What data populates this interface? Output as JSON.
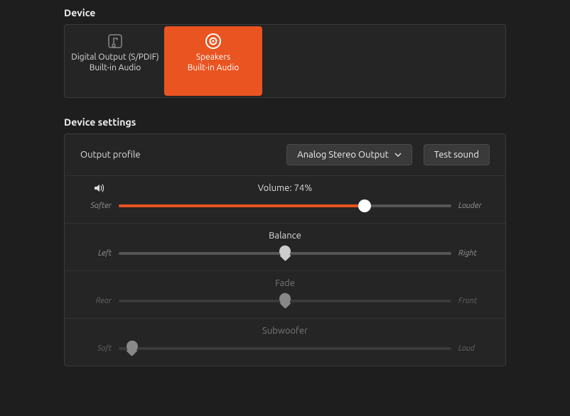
{
  "sections": {
    "device": "Device",
    "settings": "Device settings"
  },
  "devices": [
    {
      "title": "Digital Output (S/PDIF)",
      "subtitle": "Built-in Audio",
      "icon": "music-note",
      "selected": false
    },
    {
      "title": "Speakers",
      "subtitle": "Built-in Audio",
      "icon": "speaker",
      "selected": true
    }
  ],
  "profile": {
    "label": "Output profile",
    "selected": "Analog Stereo Output",
    "test_button": "Test sound"
  },
  "sliders": {
    "volume": {
      "title": "Volume: 74%",
      "left": "Softer",
      "right": "Louder",
      "value": 74,
      "fill": true,
      "enabled": true,
      "icon": "volume"
    },
    "balance": {
      "title": "Balance",
      "left": "Left",
      "right": "Right",
      "value": 50,
      "fill": false,
      "enabled": true
    },
    "fade": {
      "title": "Fade",
      "left": "Rear",
      "right": "Front",
      "value": 50,
      "fill": false,
      "enabled": false
    },
    "subwoofer": {
      "title": "Subwoofer",
      "left": "Soft",
      "right": "Loud",
      "value": 4,
      "fill": false,
      "enabled": false
    }
  }
}
